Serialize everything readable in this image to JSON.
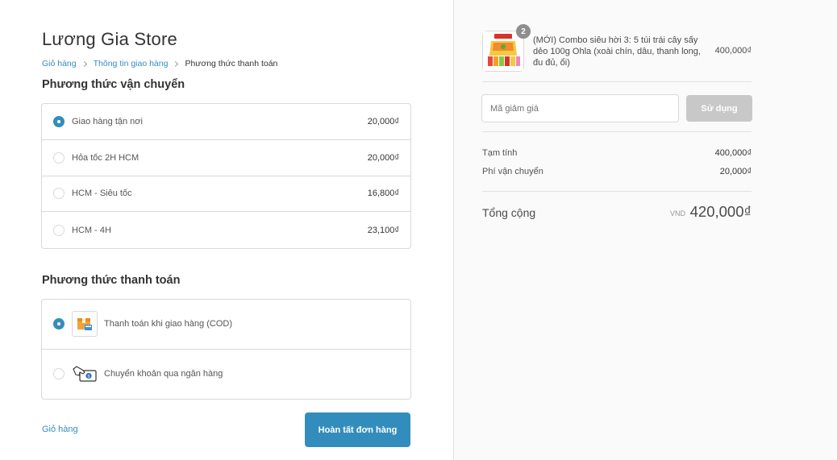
{
  "store": {
    "title": "Lương Gia Store"
  },
  "breadcrumb": {
    "items": [
      "Giỏ hàng",
      "Thông tin giao hàng",
      "Phương thức thanh toán"
    ]
  },
  "shipping": {
    "title": "Phương thức vận chuyển",
    "options": [
      {
        "label": "Giao hàng tận nơi",
        "price": "20,000₫",
        "selected": true
      },
      {
        "label": "Hỏa tốc 2H HCM",
        "price": "20,000₫",
        "selected": false
      },
      {
        "label": "HCM - Siêu tốc",
        "price": "16,800₫",
        "selected": false
      },
      {
        "label": "HCM - 4H",
        "price": "23,100₫",
        "selected": false
      }
    ]
  },
  "payment": {
    "title": "Phương thức thanh toán",
    "options": [
      {
        "label": "Thanh toán khi giao hàng (COD)",
        "icon": "cod-box-icon",
        "selected": true
      },
      {
        "label": "Chuyển khoản qua ngân hàng",
        "icon": "bank-transfer-icon",
        "selected": false
      }
    ]
  },
  "footer": {
    "back_label": "Giỏ hàng",
    "complete_label": "Hoàn tất đơn hàng"
  },
  "sidebar": {
    "product": {
      "name": "(MỚI) Combo siêu hời 3: 5 túi trái cây sấy dẻo 100g Ohla (xoài chín, dâu, thanh long, đu đủ, ổi)",
      "quantity": "2",
      "price": "400,000₫"
    },
    "discount": {
      "placeholder": "Mã giảm giá",
      "apply_label": "Sử dụng"
    },
    "summary": {
      "subtotal_label": "Tạm tính",
      "subtotal_value": "400,000₫",
      "shipping_label": "Phí vận chuyển",
      "shipping_value": "20,000₫"
    },
    "total": {
      "label": "Tổng cộng",
      "currency": "VND",
      "value": "420,000₫"
    }
  },
  "colors": {
    "accent": "#338dbc",
    "disabled_button": "#c8c8c8",
    "sidebar_bg": "#fafafa"
  }
}
